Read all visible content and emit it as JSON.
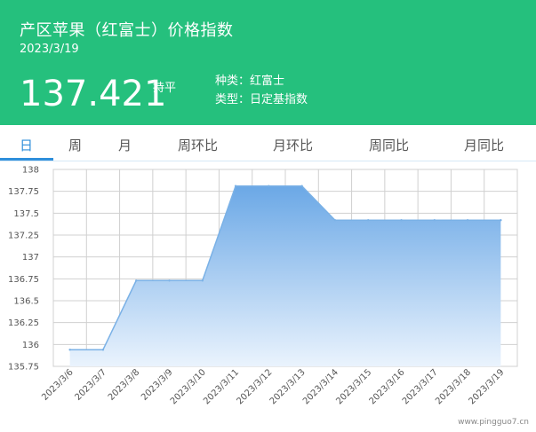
{
  "header": {
    "title": "产区苹果（红富士）价格指数",
    "date": "2023/3/19",
    "price": "137.421",
    "trend": "持平",
    "info": {
      "variety_label": "种类：",
      "variety_value": "红富士",
      "type_label": "类型：",
      "type_value": "日定基指数"
    }
  },
  "tabs": [
    {
      "label": "日",
      "active": true
    },
    {
      "label": "周",
      "active": false
    },
    {
      "label": "月",
      "active": false
    },
    {
      "label": "周环比",
      "active": false
    },
    {
      "label": "月环比",
      "active": false
    },
    {
      "label": "周同比",
      "active": false
    },
    {
      "label": "月同比",
      "active": false
    }
  ],
  "watermark": "www.pingguo7.cn",
  "colors": {
    "header_bg": "#25c07d",
    "accent": "#2f8fdb",
    "area_top": "#6ba8e6",
    "area_bottom": "#eaf3fd",
    "line": "#7ab1e6"
  },
  "chart_data": {
    "type": "area",
    "categories": [
      "2023/3/6",
      "2023/3/7",
      "2023/3/8",
      "2023/3/9",
      "2023/3/10",
      "2023/3/11",
      "2023/3/12",
      "2023/3/13",
      "2023/3/14",
      "2023/3/15",
      "2023/3/16",
      "2023/3/17",
      "2023/3/18",
      "2023/3/19"
    ],
    "values": [
      135.94,
      135.94,
      136.73,
      136.73,
      136.73,
      137.81,
      137.81,
      137.81,
      137.42,
      137.42,
      137.42,
      137.42,
      137.42,
      137.42
    ],
    "y_ticks": [
      138,
      137.75,
      137.5,
      137.25,
      137,
      136.75,
      136.5,
      136.25,
      136,
      135.75
    ],
    "ylim": [
      135.75,
      138
    ],
    "grid": true,
    "title": "",
    "xlabel": "",
    "ylabel": ""
  }
}
